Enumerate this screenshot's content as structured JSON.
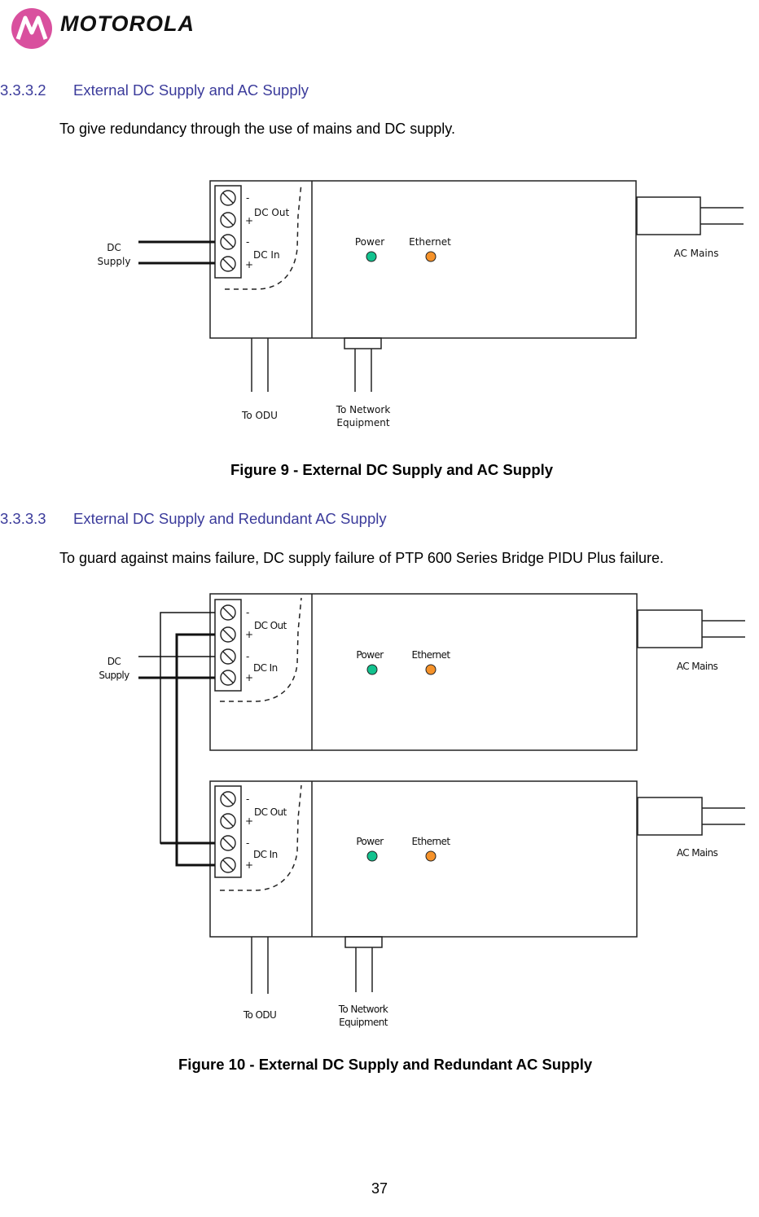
{
  "header": {
    "logo_text": "MOTOROLA",
    "brand_color": "#d9509e"
  },
  "sections": [
    {
      "number": "3.3.3.2",
      "title": "External DC Supply and AC Supply",
      "body": "To give redundancy through the use of mains and DC supply.",
      "figure_caption": "Figure 9 - External DC Supply and AC Supply"
    },
    {
      "number": "3.3.3.3",
      "title": "External DC Supply and Redundant AC Supply",
      "body": "To guard against mains failure, DC supply failure of PTP 600 Series Bridge PIDU Plus failure.",
      "figure_caption": "Figure 10 - External DC Supply and Redundant AC Supply"
    }
  ],
  "diagram_labels": {
    "dc_supply_line1": "DC",
    "dc_supply_line2": "Supply",
    "minus": "-",
    "plus": "+",
    "dc_out": "DC Out",
    "dc_in": "DC In",
    "power": "Power",
    "ethernet": "Ethernet",
    "ac_mains": "AC Mains",
    "to_odu": "To ODU",
    "to_network_line1": "To Network",
    "to_network_line2": "Equipment"
  },
  "led_colors": {
    "power": "#12c28e",
    "ethernet": "#f5922a"
  },
  "footer": {
    "page_number": "37"
  }
}
